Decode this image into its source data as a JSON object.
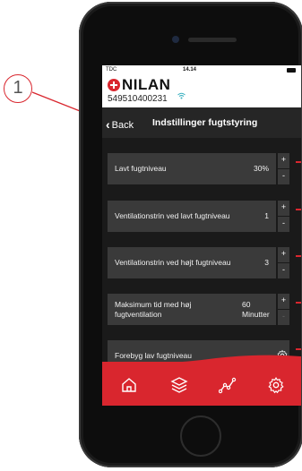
{
  "annotation": {
    "label": "1"
  },
  "status_bar": {
    "carrier": "TDC",
    "time": "14.14"
  },
  "header": {
    "brand": "NILAN",
    "device_id": "549510400231"
  },
  "nav": {
    "back_label": "Back",
    "title": "Indstillinger fugtstyring"
  },
  "settings": [
    {
      "label": "Lavt fugtniveau",
      "value": "30%"
    },
    {
      "label": "Ventilationstrin ved lavt fugtniveau",
      "value": "1"
    },
    {
      "label": "Ventilationstrin ved højt fugtniveau",
      "value": "3"
    },
    {
      "label_line1": "Maksimum tid med høj",
      "label_line2": "fugtventilation",
      "value_line1": "60",
      "value_line2": "Minutter"
    },
    {
      "label": "Forebyg lav fugtniveau"
    }
  ],
  "stepper": {
    "plus": "+",
    "minus": "-"
  },
  "tabs": [
    {
      "icon": "home-icon"
    },
    {
      "icon": "layers-icon"
    },
    {
      "icon": "graph-icon"
    },
    {
      "icon": "settings-gear-icon"
    }
  ],
  "colors": {
    "brand_red": "#d9262e",
    "row_bg": "#3a3a3a",
    "screen_bg": "#1a1a1a"
  }
}
